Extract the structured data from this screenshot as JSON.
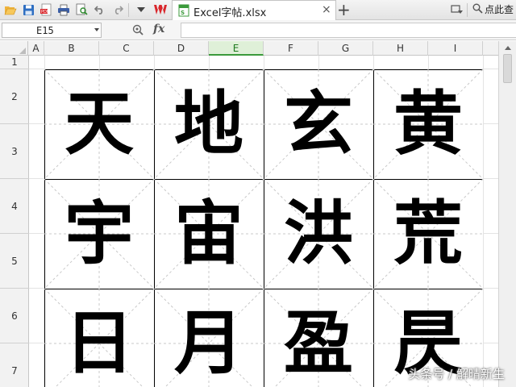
{
  "window": {
    "tab_title": "Excel字帖.xlsx",
    "tab_close": "×",
    "new_tab": "+",
    "search_label": "点此查"
  },
  "icons": {
    "open": "folder-open-icon",
    "save": "save-icon",
    "export_pdf": "pdf-icon",
    "print": "print-icon",
    "print_preview": "print-preview-icon",
    "undo": "undo-icon",
    "redo": "redo-icon",
    "customize": "dropdown-icon",
    "wps_logo": "wps-logo-icon",
    "share": "share-icon",
    "search": "search-icon",
    "zoom": "zoom-icon"
  },
  "formula_bar": {
    "cell_ref": "E15",
    "fx_label": "fx",
    "formula": ""
  },
  "columns": [
    "A",
    "B",
    "C",
    "D",
    "E",
    "F",
    "G",
    "H",
    "I"
  ],
  "active_column": "E",
  "rows": [
    "1",
    "2",
    "3",
    "4",
    "5",
    "6",
    "7"
  ],
  "copybook": {
    "characters": [
      [
        "天",
        "地",
        "玄",
        "黄"
      ],
      [
        "宇",
        "宙",
        "洪",
        "荒"
      ],
      [
        "日",
        "月",
        "盈",
        "昃"
      ]
    ]
  },
  "watermark": "头条号 / 解晴新生",
  "colors": {
    "accent_green": "#3b9a3b",
    "active_header_bg": "#dff0d8",
    "wps_red": "#d9262b",
    "guide_line": "#c8c8c8"
  }
}
